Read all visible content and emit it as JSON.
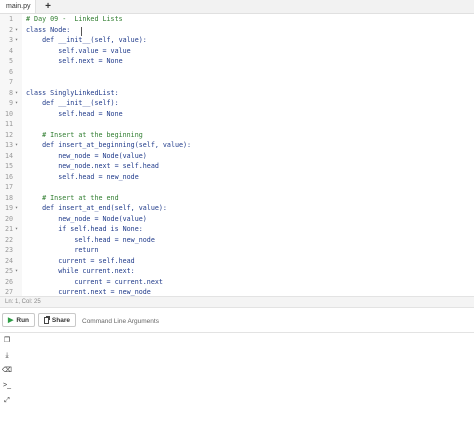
{
  "tabs": [
    {
      "label": "main.py"
    }
  ],
  "add_tab_label": "+",
  "code_lines": [
    {
      "n": "1",
      "fold": "",
      "text": "# Day 09 -  Linked Lists",
      "kind": "comment"
    },
    {
      "n": "2",
      "fold": "▾",
      "text": "class Node:",
      "kind": "code"
    },
    {
      "n": "3",
      "fold": "▾",
      "text": "    def __init__(self, value):",
      "kind": "code"
    },
    {
      "n": "4",
      "fold": "",
      "text": "        self.value = value",
      "kind": "code"
    },
    {
      "n": "5",
      "fold": "",
      "text": "        self.next = None",
      "kind": "code"
    },
    {
      "n": "6",
      "fold": "",
      "text": "",
      "kind": "code"
    },
    {
      "n": "7",
      "fold": "",
      "text": "",
      "kind": "code"
    },
    {
      "n": "8",
      "fold": "▾",
      "text": "class SinglyLinkedList:",
      "kind": "code"
    },
    {
      "n": "9",
      "fold": "▾",
      "text": "    def __init__(self):",
      "kind": "code"
    },
    {
      "n": "10",
      "fold": "",
      "text": "        self.head = None",
      "kind": "code"
    },
    {
      "n": "11",
      "fold": "",
      "text": "",
      "kind": "code"
    },
    {
      "n": "12",
      "fold": "",
      "text": "    # Insert at the beginning",
      "kind": "comment"
    },
    {
      "n": "13",
      "fold": "▾",
      "text": "    def insert_at_beginning(self, value):",
      "kind": "code"
    },
    {
      "n": "14",
      "fold": "",
      "text": "        new_node = Node(value)",
      "kind": "code"
    },
    {
      "n": "15",
      "fold": "",
      "text": "        new_node.next = self.head",
      "kind": "code"
    },
    {
      "n": "16",
      "fold": "",
      "text": "        self.head = new_node",
      "kind": "code"
    },
    {
      "n": "17",
      "fold": "",
      "text": "",
      "kind": "code"
    },
    {
      "n": "18",
      "fold": "",
      "text": "    # Insert at the end",
      "kind": "comment"
    },
    {
      "n": "19",
      "fold": "▾",
      "text": "    def insert_at_end(self, value):",
      "kind": "code"
    },
    {
      "n": "20",
      "fold": "",
      "text": "        new_node = Node(value)",
      "kind": "code"
    },
    {
      "n": "21",
      "fold": "▾",
      "text": "        if self.head is None:",
      "kind": "code"
    },
    {
      "n": "22",
      "fold": "",
      "text": "            self.head = new_node",
      "kind": "code"
    },
    {
      "n": "23",
      "fold": "",
      "text": "            return",
      "kind": "code"
    },
    {
      "n": "24",
      "fold": "",
      "text": "        current = self.head",
      "kind": "code"
    },
    {
      "n": "25",
      "fold": "▾",
      "text": "        while current.next:",
      "kind": "code"
    },
    {
      "n": "26",
      "fold": "",
      "text": "            current = current.next",
      "kind": "code"
    },
    {
      "n": "27",
      "fold": "",
      "text": "        current.next = new_node",
      "kind": "code"
    }
  ],
  "status": {
    "position": "Ln: 1,  Col: 25"
  },
  "toolbar": {
    "run_label": "Run",
    "share_label": "Share",
    "cli_placeholder": "Command Line Arguments"
  },
  "console_tools": [
    {
      "name": "copy-icon",
      "glyph": "❐"
    },
    {
      "name": "download-icon",
      "glyph": "⤓"
    },
    {
      "name": "clear-icon",
      "glyph": "⌫"
    },
    {
      "name": "terminal-icon",
      "glyph": ">_"
    },
    {
      "name": "expand-icon",
      "glyph": "⤢"
    }
  ],
  "colors": {
    "comment": "#2f7d2f",
    "code": "#1f3a8a",
    "run_green": "#2e9d45"
  }
}
